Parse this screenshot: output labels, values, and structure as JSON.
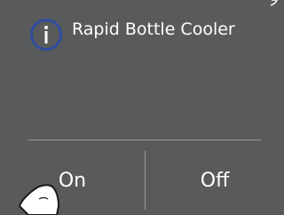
{
  "dialog": {
    "title": "Rapid Bottle Cooler",
    "icon": "info-icon"
  },
  "buttons": {
    "on_label": "On",
    "off_label": "Off"
  },
  "colors": {
    "background": "#595a5b",
    "text": "#ffffff",
    "icon_ring": "#2d4da0",
    "divider": "#9a9b9c"
  }
}
